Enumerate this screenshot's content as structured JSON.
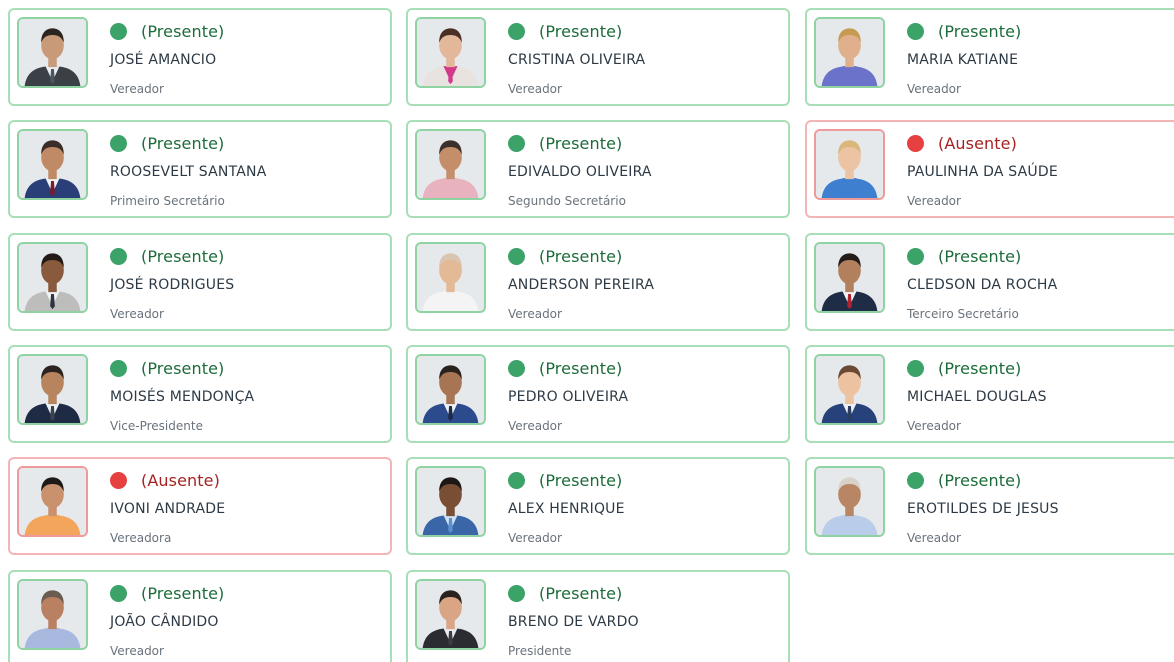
{
  "members": [
    {
      "status": "(Presente)",
      "present": true,
      "name": "JOSÉ AMANCIO",
      "role": "Vereador",
      "skin": "#c99a78",
      "shirt": "#e9edf1",
      "suit": "#3b3f46",
      "tie": "#4a5563",
      "hair": "#2b2420"
    },
    {
      "status": "(Presente)",
      "present": true,
      "name": "CRISTINA OLIVEIRA",
      "role": "Vereador",
      "skin": "#e2b79a",
      "shirt": "#d23a8a",
      "suit": "#e9e3df",
      "tie": "#d23a8a",
      "hair": "#4a2f24"
    },
    {
      "status": "(Presente)",
      "present": true,
      "name": "MARIA KATIANE",
      "role": "Vereador",
      "skin": "#e0b08c",
      "shirt": "#6a73c9",
      "suit": "#6a73c9",
      "tie": "#6a73c9",
      "hair": "#c79a52"
    },
    {
      "status": "(Presente)",
      "present": true,
      "name": "ROOSEVELT SANTANA",
      "role": "Primeiro Secretário",
      "skin": "#c18a66",
      "shirt": "#eef1f4",
      "suit": "#2a3f77",
      "tie": "#7a1c2b",
      "hair": "#3a2d28"
    },
    {
      "status": "(Presente)",
      "present": true,
      "name": "EDIVALDO OLIVEIRA",
      "role": "Segundo Secretário",
      "skin": "#c58e6b",
      "shirt": "#e8b3bf",
      "suit": "#e8b3bf",
      "tie": "#e8b3bf",
      "hair": "#3a302c"
    },
    {
      "status": "(Ausente)",
      "present": false,
      "name": "PAULINHA DA SAÚDE",
      "role": "Vereador",
      "skin": "#ecc3a3",
      "shirt": "#3e7fcf",
      "suit": "#3e7fcf",
      "tie": "#3e7fcf",
      "hair": "#d9b77a"
    },
    {
      "status": "(Presente)",
      "present": true,
      "name": "JOSÉ RODRIGUES",
      "role": "Vereador",
      "skin": "#8a5a3c",
      "shirt": "#f0f2f4",
      "suit": "#bdbdbb",
      "tie": "#2f3440",
      "hair": "#221b18"
    },
    {
      "status": "(Presente)",
      "present": true,
      "name": "ANDERSON PEREIRA",
      "role": "Vereador",
      "skin": "#e3b996",
      "shirt": "#f4f4f4",
      "suit": "#f4f4f4",
      "tie": "#f4f4f4",
      "hair": "#d9c4b0"
    },
    {
      "status": "(Presente)",
      "present": true,
      "name": "CLEDSON DA ROCHA",
      "role": "Terceiro Secretário",
      "skin": "#b3805e",
      "shirt": "#f1f3f5",
      "suit": "#1f2c46",
      "tie": "#b32130",
      "hair": "#231d1a"
    },
    {
      "status": "(Presente)",
      "present": true,
      "name": "MOISÉS MENDONÇA",
      "role": "Vice-Presidente",
      "skin": "#b7845f",
      "shirt": "#eef1f4",
      "suit": "#1f2a44",
      "tie": "#3a4150",
      "hair": "#2b2420"
    },
    {
      "status": "(Presente)",
      "present": true,
      "name": "PEDRO OLIVEIRA",
      "role": "Vereador",
      "skin": "#a87554",
      "shirt": "#eef1f4",
      "suit": "#2b4b8c",
      "tie": "#1d2a4a",
      "hair": "#2a221f"
    },
    {
      "status": "(Presente)",
      "present": true,
      "name": "MICHAEL DOUGLAS",
      "role": "Vereador",
      "skin": "#ecc2a1",
      "shirt": "#eef1f4",
      "suit": "#27427a",
      "tie": "#2d3e63",
      "hair": "#6b4a34"
    },
    {
      "status": "(Ausente)",
      "present": false,
      "name": "IVONI ANDRADE",
      "role": "Vereadora",
      "skin": "#c9916d",
      "shirt": "#f3a55c",
      "suit": "#f3a55c",
      "tie": "#f3a55c",
      "hair": "#1e1a1a"
    },
    {
      "status": "(Presente)",
      "present": true,
      "name": "ALEX HENRIQUE",
      "role": "Vereador",
      "skin": "#7a4e35",
      "shirt": "#cfe0f2",
      "suit": "#3a66a8",
      "tie": "#5c8fd0",
      "hair": "#1d1816"
    },
    {
      "status": "(Presente)",
      "present": true,
      "name": "EROTILDES DE JESUS",
      "role": "Vereador",
      "skin": "#b98665",
      "shirt": "#b9cdea",
      "suit": "#b9cdea",
      "tie": "#b9cdea",
      "hair": "#d8d2cb"
    },
    {
      "status": "(Presente)",
      "present": true,
      "name": "JOÃO CÂNDIDO",
      "role": "Vereador",
      "skin": "#b98161",
      "shirt": "#a9b8df",
      "suit": "#a9b8df",
      "tie": "#a9b8df",
      "hair": "#6b5c52"
    },
    {
      "status": "(Presente)",
      "present": true,
      "name": "BRENO DE VARDO",
      "role": "Presidente",
      "skin": "#d9a584",
      "shirt": "#e8ebee",
      "suit": "#2a2c31",
      "tie": "#3a3d44",
      "hair": "#2a221f"
    }
  ]
}
